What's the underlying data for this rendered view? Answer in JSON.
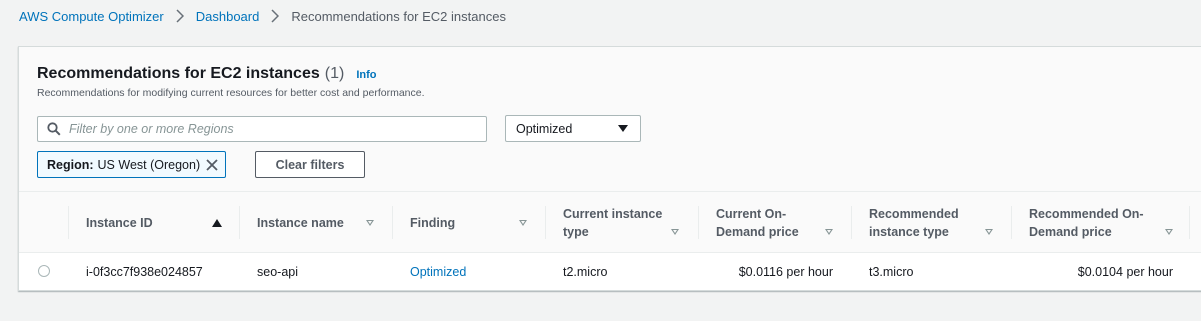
{
  "breadcrumb": {
    "items": [
      "AWS Compute Optimizer",
      "Dashboard"
    ],
    "current": "Recommendations for EC2 instances"
  },
  "header": {
    "title": "Recommendations for EC2 instances",
    "count": "(1)",
    "info": "Info",
    "description": "Recommendations for modifying current resources for better cost and performance."
  },
  "filter": {
    "placeholder": "Filter by one or more Regions",
    "value": ""
  },
  "finding_select": {
    "value": "Optimized"
  },
  "token": {
    "key": "Region:",
    "value": "US West (Oregon)"
  },
  "clear_filters": "Clear filters",
  "table": {
    "columns": [
      "Instance ID",
      "Instance name",
      "Finding",
      "Current instance type",
      "Current On-Demand price",
      "Recommended instance type",
      "Recommended On-Demand price"
    ],
    "rows": [
      {
        "instance_id": "i-0f3cc7f938e024857",
        "instance_name": "seo-api",
        "finding": "Optimized",
        "current_type": "t2.micro",
        "current_price": "$0.0116 per hour",
        "recommended_type": "t3.micro",
        "recommended_price": "$0.0104 per hour"
      }
    ]
  },
  "colors": {
    "link": "#0073bb",
    "token_bg": "#f1faff",
    "header_bg": "#fafafa"
  }
}
